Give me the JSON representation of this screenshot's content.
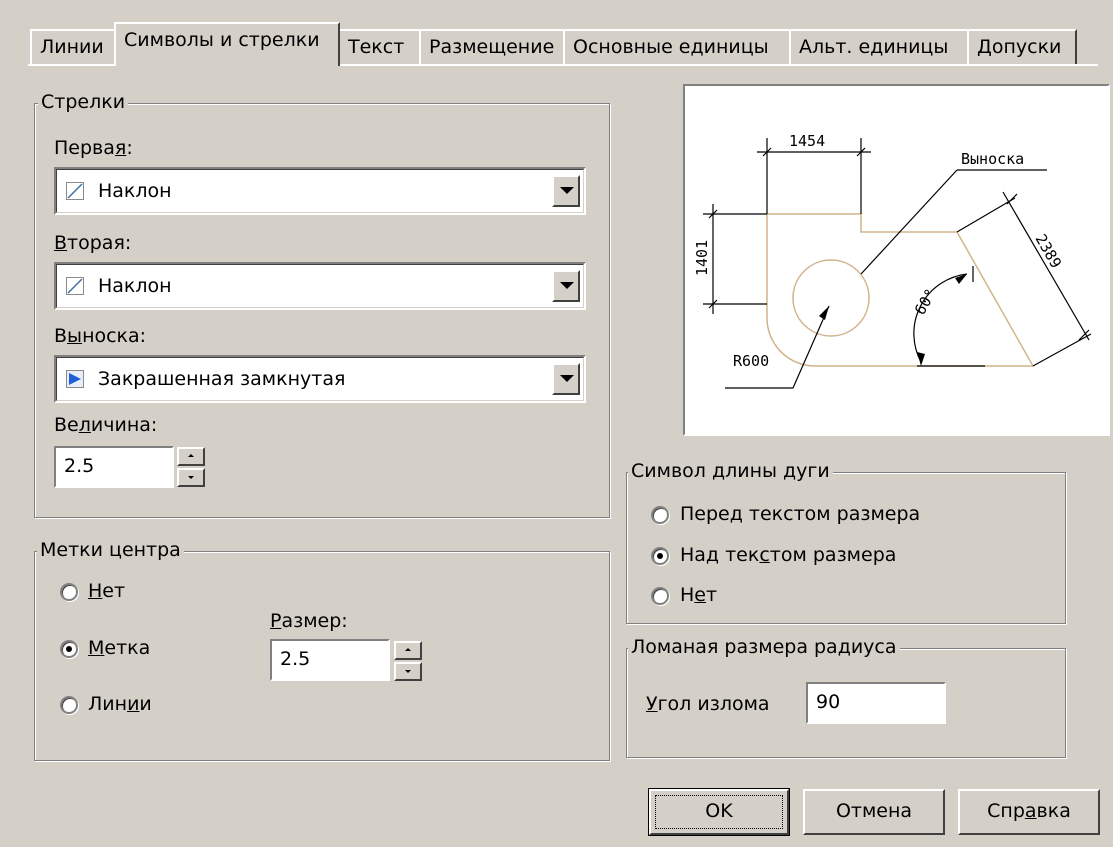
{
  "tabs": [
    {
      "label": "Линии",
      "active": false
    },
    {
      "label": "Символы и стрелки",
      "active": true
    },
    {
      "label": "Текст",
      "active": false
    },
    {
      "label": "Размещение",
      "active": false
    },
    {
      "label": "Основные единицы",
      "active": false
    },
    {
      "label": "Альт. единицы",
      "active": false
    },
    {
      "label": "Допуски",
      "active": false
    }
  ],
  "arrows": {
    "group_title": "Стрелки",
    "first_label": "Первая:",
    "first_value": "Наклон",
    "second_label": "Вторая:",
    "second_value": "Наклон",
    "leader_label": "Выноска:",
    "leader_value": "Закрашенная замкнутая",
    "size_label": "Величина:",
    "size_value": "2.5"
  },
  "center_marks": {
    "group_title": "Метки центра",
    "options": [
      "Нет",
      "Метка",
      "Линии"
    ],
    "selected": "Метка",
    "size_label": "Размер:",
    "size_value": "2.5"
  },
  "preview": {
    "dim_top": "1454",
    "dim_left": "1401",
    "dim_right": "2389",
    "angle": "60°",
    "radius": "R600",
    "leader_text": "Выноска"
  },
  "arc_length": {
    "group_title": "Символ длины дуги",
    "options": [
      "Перед текстом размера",
      "Над текстом размера",
      "Нет"
    ],
    "selected": "Над текстом размера"
  },
  "radius_jog": {
    "group_title": "Ломаная размера радиуса",
    "angle_label": "Угол излома",
    "angle_value": "90"
  },
  "buttons": {
    "ok": "OK",
    "cancel": "Отмена",
    "help": "Справка"
  },
  "colors": {
    "dialog_bg": "#d4d0c8",
    "preview_outline": "#d2b48c",
    "arrow_icon": "#1e5fd8"
  }
}
